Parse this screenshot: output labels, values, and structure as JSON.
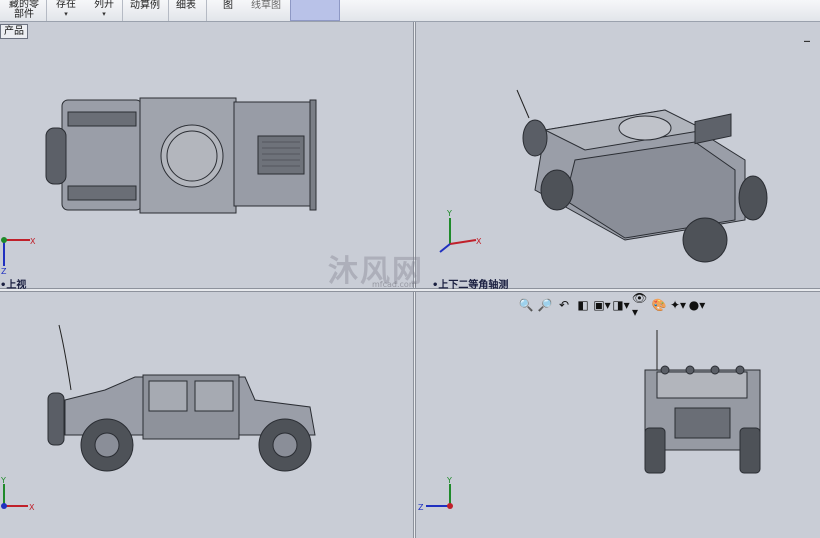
{
  "toolbar": {
    "items": [
      {
        "label": "藏的零\n部件",
        "caret": false
      },
      {
        "label": "存在",
        "caret": true
      },
      {
        "label": "列开",
        "caret": true
      },
      {
        "label": "动算例",
        "caret": false
      },
      {
        "label": "细表",
        "caret": false
      },
      {
        "label": "图",
        "caret": false
      },
      {
        "label": "线草图",
        "caret": false
      }
    ]
  },
  "tree_tab": "产品",
  "viewports": {
    "top_left": {
      "label": "上视"
    },
    "top_right": {
      "label": "上下二等角轴测"
    },
    "bottom_left": {
      "label": ""
    },
    "bottom_right": {
      "label": ""
    }
  },
  "axes": {
    "x": "X",
    "y": "Y",
    "z": "Z"
  },
  "minimize": "_",
  "view_tools": [
    "zoom-to-fit-icon",
    "zoom-area-icon",
    "previous-view-icon",
    "section-view-icon",
    "view-orientation-icon",
    "display-style-icon",
    "hide-show-icon",
    "edit-appearance-icon",
    "apply-scene-icon",
    "view-settings-icon"
  ],
  "watermark": {
    "logo_text": "沐风网",
    "site": "mfcad.com"
  },
  "colors": {
    "background": "#c9cdd6",
    "model": "#8a8e98",
    "x_axis": "#c0202a",
    "y_axis": "#1f8a2a",
    "z_axis": "#2030c0"
  }
}
